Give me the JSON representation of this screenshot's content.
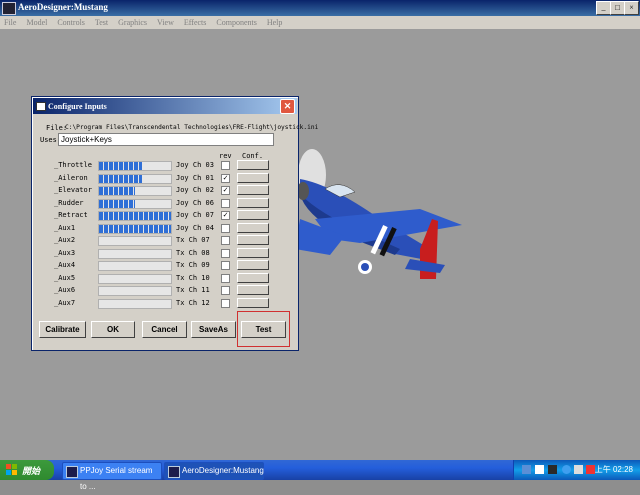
{
  "app": {
    "title": "AeroDesigner:Mustang",
    "menu": [
      "File",
      "Model",
      "Controls",
      "Test",
      "Graphics",
      "View",
      "Effects",
      "Components",
      "Help"
    ]
  },
  "dialog": {
    "title": "Configure Inputs",
    "file_label": "File:",
    "file_path": "C:\\Program Files\\Transcendental Technologies\\FRE-Flight\\joystick.ini",
    "uses_label": "Uses:",
    "uses_value": "Joystick+Keys",
    "rev_header": "rev",
    "conf_header": "Conf.",
    "rows": [
      {
        "label": "_Throttle",
        "level": 0.6,
        "channel": "Joy Ch 03",
        "rev": false
      },
      {
        "label": "_Aileron",
        "level": 0.6,
        "channel": "Joy Ch 01",
        "rev": true
      },
      {
        "label": "_Elevator",
        "level": 0.5,
        "channel": "Joy Ch 02",
        "rev": true
      },
      {
        "label": "_Rudder",
        "level": 0.5,
        "channel": "Joy Ch 06",
        "rev": false
      },
      {
        "label": "_Retract",
        "level": 1.0,
        "channel": "Joy Ch 07",
        "rev": true
      },
      {
        "label": "_Aux1",
        "level": 1.0,
        "channel": "Joy Ch 04",
        "rev": false
      },
      {
        "label": "_Aux2",
        "level": 0,
        "channel": "Tx Ch 07",
        "rev": false
      },
      {
        "label": "_Aux3",
        "level": 0,
        "channel": "Tx Ch 08",
        "rev": false
      },
      {
        "label": "_Aux4",
        "level": 0,
        "channel": "Tx Ch 09",
        "rev": false
      },
      {
        "label": "_Aux5",
        "level": 0,
        "channel": "Tx Ch 10",
        "rev": false
      },
      {
        "label": "_Aux6",
        "level": 0,
        "channel": "Tx Ch 11",
        "rev": false
      },
      {
        "label": "_Aux7",
        "level": 0,
        "channel": "Tx Ch 12",
        "rev": false
      }
    ],
    "buttons": {
      "calibrate": "Calibrate",
      "ok": "OK",
      "cancel": "Cancel",
      "saveas": "SaveAs",
      "test": "Test"
    },
    "highlight_color": "#d03030"
  },
  "taskbar": {
    "start_label": "開始",
    "tasks": [
      "PPJoy Serial stream to ...",
      "AeroDesigner:Mustang"
    ],
    "clock": "上午 02:28"
  },
  "colors": {
    "title_blue": "#0a246a",
    "plane_blue": "#2a4fb8",
    "plane_red": "#c81e1e",
    "viewport_gray": "#9b9b9b"
  }
}
